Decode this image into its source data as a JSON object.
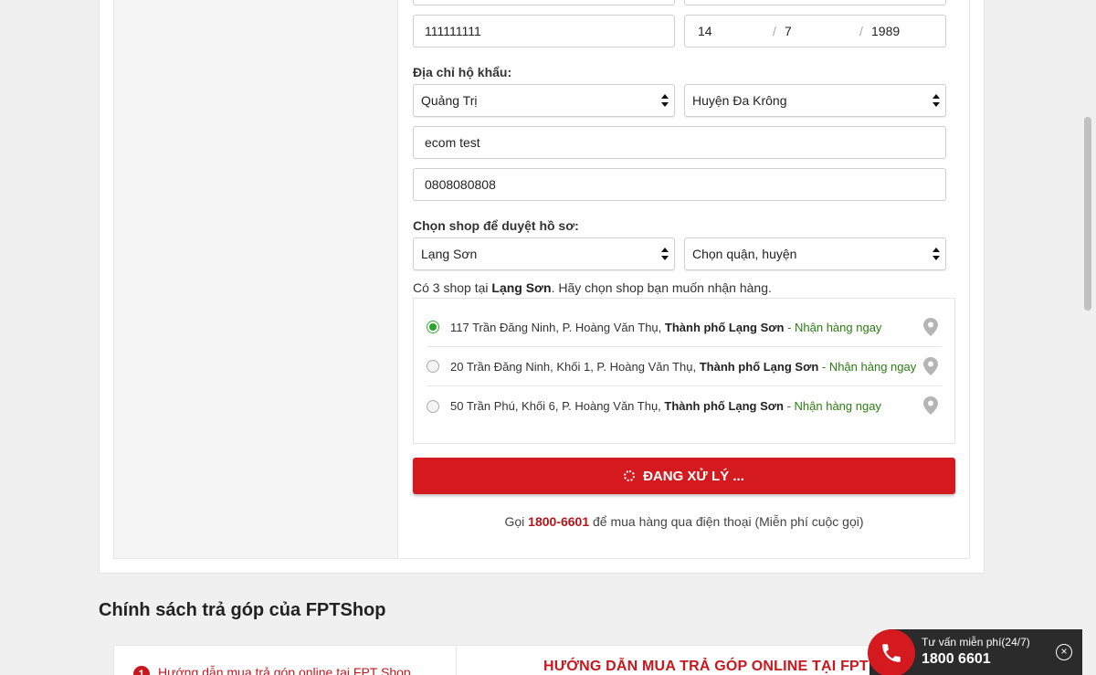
{
  "form": {
    "id_number": "111111111",
    "dob": {
      "day": "14",
      "month": "7",
      "year": "1989",
      "sep": "/"
    },
    "household_label": "Địa chỉ hộ khẩu:",
    "province": "Quảng Trị",
    "district": "Huyện Đa Krông",
    "address": "ecom test",
    "phone": "0808080808",
    "shop_label": "Chọn shop để duyệt hồ sơ:",
    "shop_province": "Lạng Sơn",
    "shop_district": "Chọn quận, huyện"
  },
  "shops": {
    "note_prefix": "Có 3 shop tại ",
    "note_city": "Lạng Sơn",
    "note_suffix": ". Hãy chọn shop bạn muốn nhận hàng.",
    "items": [
      {
        "address": "117 Trần Đăng Ninh, P. Hoàng Văn Thụ, ",
        "city": "Thành phố Lạng Sơn",
        "status": " - Nhận hàng ngay",
        "selected": true
      },
      {
        "address": "20 Trần Đăng Ninh, Khối 1, P. Hoàng Văn Thụ, ",
        "city": "Thành phố Lạng Sơn",
        "status": " - Nhận hàng ngay",
        "selected": false
      },
      {
        "address": "50 Trần Phú, Khối 6, P. Hoàng Văn Thụ, ",
        "city": "Thành phố Lạng Sơn",
        "status": " - Nhận hàng ngay",
        "selected": false
      }
    ]
  },
  "submit": {
    "label": "ĐANG XỬ LÝ ..."
  },
  "call": {
    "prefix": "Gọi ",
    "hotline": "1800-6601",
    "suffix": " để mua hàng qua điện thoại (Miễn phí cuộc gọi)"
  },
  "policy": {
    "title": "Chính sách trả góp của FPTShop",
    "guide_number": "1",
    "guide_link": "Hướng dẫn mua trả góp online tại FPT Shop",
    "guide_title": "HƯỚNG DẪN MUA TRẢ GÓP ONLINE TẠI FPT SHOP"
  },
  "hotline_widget": {
    "label": "Tư vấn miễn phí(24/7)",
    "number": "1800 6601",
    "close": "×"
  },
  "colors": {
    "brand_red": "#d41a1f",
    "available_green": "#2b7d12"
  }
}
